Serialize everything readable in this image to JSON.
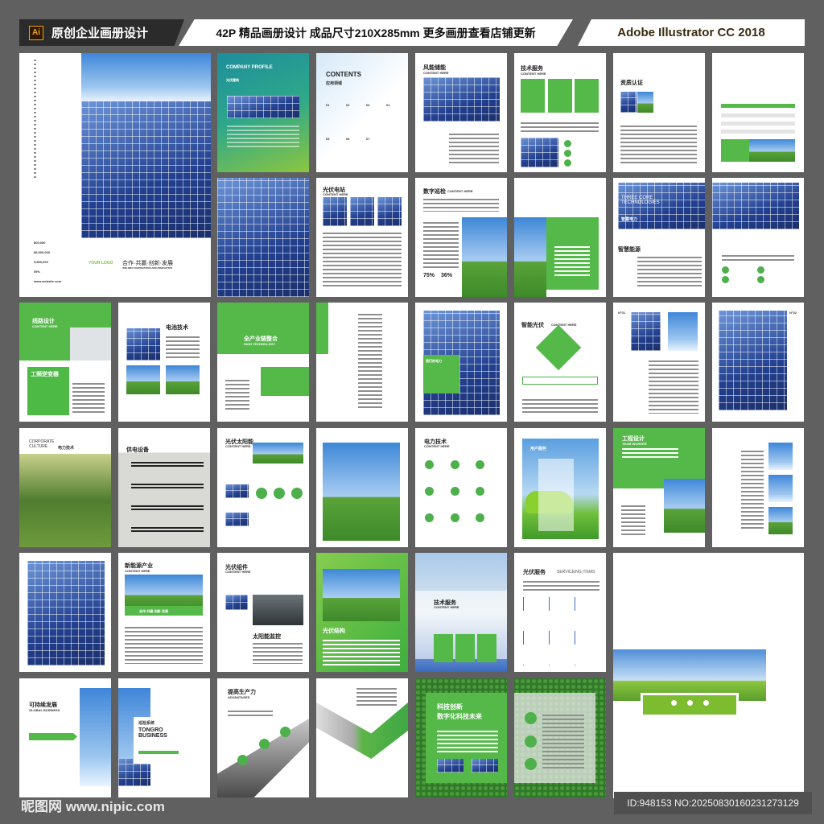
{
  "header": {
    "badge_icon": "Ai",
    "left": "原创企业画册设计",
    "center": "42P 精品画册设计 成品尺寸210X285mm 更多画册查看店铺更新",
    "right": "Adobe Illustrator CC 2018"
  },
  "footer": {
    "watermark": "昵图网 www.nipic.com",
    "id": "ID:948153 NO:20250830160231273129"
  },
  "cover": {
    "logo": "YOUR LOGO",
    "slogan": "合作·共赢·创新·发展",
    "slogan_en": "WIN-WIN COOPERATION AND INNOVATION",
    "stats": [
      "800,000",
      "86,000,000",
      "5,800,000",
      "95%"
    ],
    "website": "www.website.com"
  },
  "pages": {
    "profile": {
      "title": "COMPANY PROFILE",
      "sub": "光伏建筑"
    },
    "contents": {
      "title": "CONTENTS",
      "sub": "应用领域",
      "nums": [
        "01",
        "02",
        "03",
        "04",
        "05",
        "06",
        "07"
      ]
    },
    "wind": {
      "title": "风能储能",
      "sub": "CONTENT HERE"
    },
    "tech": {
      "title": "技术服务",
      "sub": "CONTENT HERE"
    },
    "cert": {
      "title": "资质认证"
    },
    "station": {
      "title": "光伏电站",
      "sub": "CONTENT HERE"
    },
    "digital": {
      "title": "数字巡检",
      "sub": "CONTENT HERE",
      "p1": "75%",
      "p2": "36%"
    },
    "three": {
      "title": "THREE CORE TECHNOLOGIES",
      "sub": "智慧电力",
      "sub2": "智慧能源"
    },
    "line": {
      "title": "线路设计",
      "sub": "CONTENT HERE",
      "box": "工频逆变器"
    },
    "battery": {
      "title": "电池技术"
    },
    "chain": {
      "title": "全产业链整合",
      "sub": "HIGH TECHNOLOGY"
    },
    "power": {
      "title": "我们的电力"
    },
    "smart": {
      "title": "智能光伏",
      "sub": "CONTENT HERE"
    },
    "n1": {
      "title": "N°01"
    },
    "n2": {
      "title": "N°02"
    },
    "culture": {
      "title": "CORPORATE CULTURE",
      "sub": "电力技术"
    },
    "supply": {
      "title": "供电设备"
    },
    "solarenergy": {
      "title": "光伏太阳能",
      "sub": "CONTENT HERE"
    },
    "ptech": {
      "title": "电力技术",
      "sub": "CONTENT HERE"
    },
    "user": {
      "title": "用户服务"
    },
    "eng": {
      "title": "工程设计",
      "sub": "TEAM WORKER"
    },
    "newenergy": {
      "title": "新能源产业",
      "sub": "CONTENT HERE",
      "band": "合作·共赢·创新·发展"
    },
    "module": {
      "title": "光伏组件",
      "sub": "CONTENT HERE",
      "sub2": "太阳能监控"
    },
    "struct": {
      "title": "光伏结构"
    },
    "tech2": {
      "title": "技术服务",
      "sub": "CONTENT HERE"
    },
    "service": {
      "title": "光伏服务",
      "sub": "SERVICEING ITEMS"
    },
    "sustain": {
      "title": "可持续发展",
      "sub": "GLOBAL BUSINESS"
    },
    "patrol": {
      "title": "巡检系统",
      "sub": "TONGRO BUSINESS"
    },
    "adv": {
      "title": "提高生产力",
      "sub": "ADVANTAGES"
    },
    "innov": {
      "title": "科技创新",
      "sub": "数字化科技未来"
    }
  },
  "colors": {
    "accent": "#4db04a",
    "background": "#606060"
  }
}
